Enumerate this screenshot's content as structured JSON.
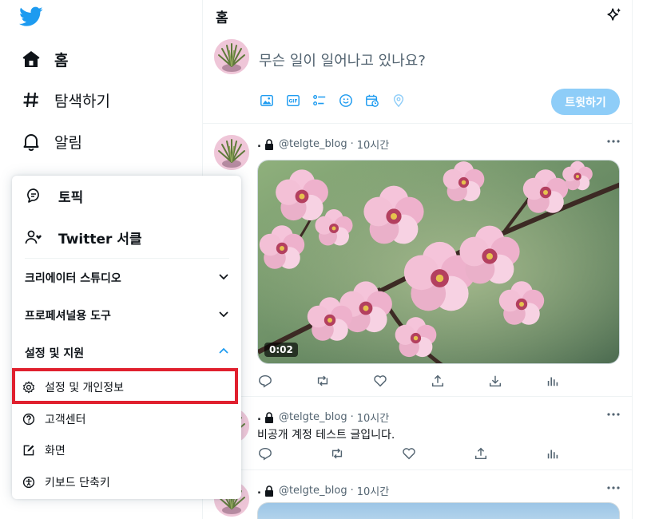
{
  "colors": {
    "accent": "#1d9bf0",
    "tweet_button": "#8ecdf8",
    "highlight": "#e0202e",
    "text": "#0f1419",
    "muted": "#536471"
  },
  "nav": {
    "logo": "twitter-bird-icon",
    "items": [
      {
        "label": "홈",
        "icon": "home-icon",
        "bold": true
      },
      {
        "label": "탐색하기",
        "icon": "hashtag-icon"
      },
      {
        "label": "알림",
        "icon": "bell-icon"
      }
    ]
  },
  "menu": {
    "items": [
      {
        "label": "토픽",
        "icon": "topic-icon"
      },
      {
        "label": "Twitter 서클",
        "icon": "circle-people-icon"
      }
    ],
    "sections": [
      {
        "label": "크리에이터 스튜디오",
        "icon": "chevron-down-icon"
      },
      {
        "label": "프로페셔널용 도구",
        "icon": "chevron-down-icon"
      },
      {
        "label": "설정 및 지원",
        "icon": "chevron-up-icon"
      }
    ],
    "support_items": [
      {
        "label": "설정 및 개인정보",
        "icon": "gear-icon",
        "highlighted": true
      },
      {
        "label": "고객센터",
        "icon": "help-icon"
      },
      {
        "label": "화면",
        "icon": "display-icon"
      },
      {
        "label": "키보드 단축키",
        "icon": "accessibility-icon"
      }
    ]
  },
  "header": {
    "title": "홈",
    "icon": "sparkle-icon"
  },
  "compose": {
    "placeholder": "무슨 일이 일어나고 있나요?",
    "tools": [
      "image-icon",
      "gif-icon",
      "poll-icon",
      "emoji-icon",
      "schedule-icon",
      "location-icon"
    ],
    "button": "트윗하기"
  },
  "tweets": [
    {
      "name": ".",
      "handle": "@telgte_blog",
      "separator": "·",
      "time": "10시간",
      "text": "",
      "media_duration": "0:02"
    },
    {
      "name": ".",
      "handle": "@telgte_blog",
      "separator": "·",
      "time": "10시간",
      "text": "비공개 계정 테스트 글입니다."
    },
    {
      "name": ".",
      "handle": "@telgte_blog",
      "separator": "·",
      "time": "10시간",
      "text": ""
    }
  ],
  "tweet_actions": [
    "reply-icon",
    "retweet-icon",
    "like-icon",
    "share-icon",
    "download-icon",
    "analytics-icon"
  ]
}
